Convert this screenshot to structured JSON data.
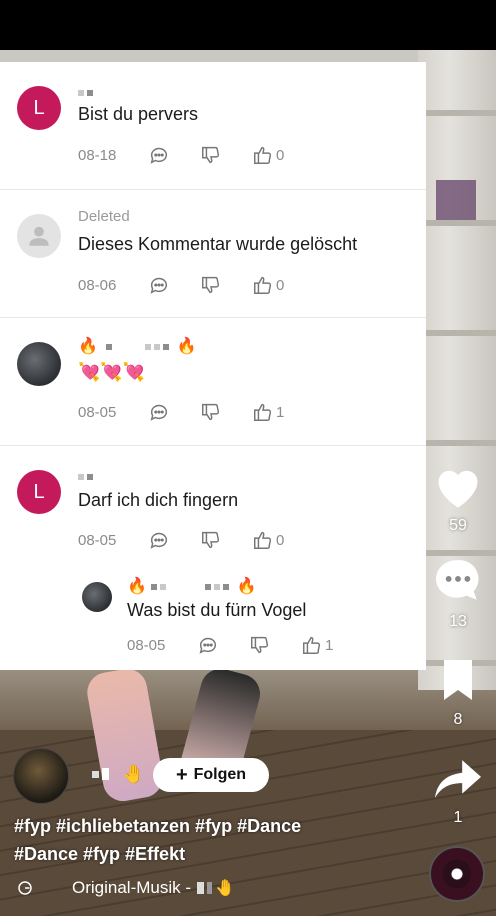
{
  "comments": [
    {
      "avatar_letter": "L",
      "text": "Bist du pervers",
      "date": "08-18",
      "likes": "0"
    },
    {
      "username": "Deleted",
      "text": "Dieses Kommentar wurde gelöscht",
      "date": "08-06",
      "likes": "0"
    },
    {
      "username_emoji_left": "🔥",
      "username_emoji_right": "🔥",
      "text": "💘💘💘",
      "date": "08-05",
      "likes": "1"
    },
    {
      "avatar_letter": "L",
      "text": "Darf ich dich fingern",
      "date": "08-05",
      "likes": "0"
    },
    {
      "username_emoji_left": "🔥",
      "username_emoji_right": "🔥",
      "text": "Was bist du fürn Vogel",
      "date": "08-05",
      "likes": "1"
    }
  ],
  "rail": {
    "likes": "59",
    "comments": "13",
    "saves": "8",
    "shares": "1"
  },
  "author": {
    "handle_emoji": "🤚",
    "follow_label": "Folgen"
  },
  "caption": {
    "line1": "#fyp #ichliebetanzen #fyp #Dance",
    "line2": "#Dance #fyp #Effekt"
  },
  "music": {
    "label": "Original-Musik -",
    "emoji": "🤚"
  },
  "colors": {
    "avatar_l": "#c41a5c",
    "panel_bg": "#ffffff"
  }
}
